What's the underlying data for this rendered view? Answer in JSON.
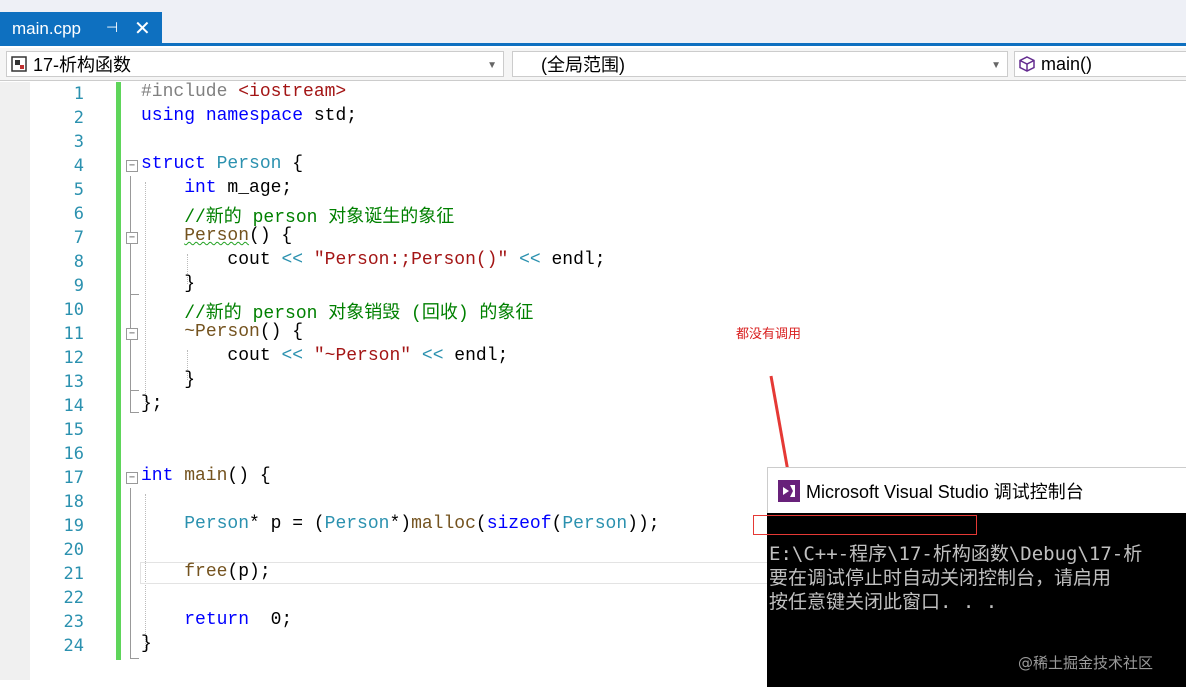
{
  "tab": {
    "title": "main.cpp",
    "pin": "⊣",
    "close": "✕"
  },
  "navbar": {
    "project": "17-析构函数",
    "scope": "(全局范围)",
    "member": "main()"
  },
  "editor": {
    "lines": [
      {
        "n": "1"
      },
      {
        "n": "2"
      },
      {
        "n": "3"
      },
      {
        "n": "4"
      },
      {
        "n": "5"
      },
      {
        "n": "6"
      },
      {
        "n": "7"
      },
      {
        "n": "8"
      },
      {
        "n": "9"
      },
      {
        "n": "10"
      },
      {
        "n": "11"
      },
      {
        "n": "12"
      },
      {
        "n": "13"
      },
      {
        "n": "14"
      },
      {
        "n": "15"
      },
      {
        "n": "16"
      },
      {
        "n": "17"
      },
      {
        "n": "18"
      },
      {
        "n": "19"
      },
      {
        "n": "20"
      },
      {
        "n": "21"
      },
      {
        "n": "22"
      },
      {
        "n": "23"
      },
      {
        "n": "24"
      }
    ],
    "code": {
      "l1a": "#include ",
      "l1b": "<iostream>",
      "l2a": "using",
      "l2b": " namespace",
      "l2c": " std;",
      "l4a": "struct",
      "l4b": " Person",
      "l4c": " {",
      "l5a": "    int",
      "l5b": " m_age;",
      "l6": "    //新的 person 对象诞生的象征",
      "l7a": "    ",
      "l7b": "Person",
      "l7c": "() {",
      "l8a": "        cout ",
      "l8b": "<<",
      "l8c": " \"Person:;Person()\"",
      "l8d": " ",
      "l8e": "<<",
      "l8f": " endl;",
      "l9": "    }",
      "l10": "    //新的 person 对象销毁 (回收) 的象征",
      "l11a": "    ",
      "l11b": "~Person",
      "l11c": "() {",
      "l12a": "        cout ",
      "l12b": "<<",
      "l12c": " \"~Person\"",
      "l12d": " ",
      "l12e": "<<",
      "l12f": " endl;",
      "l13": "    }",
      "l14": "};",
      "l17a": "int",
      "l17b": " main",
      "l17c": "() {",
      "l19a": "    ",
      "l19b": "Person",
      "l19c": "* p = (",
      "l19d": "Person",
      "l19e": "*)",
      "l19f": "malloc",
      "l19g": "(",
      "l19h": "sizeof",
      "l19i": "(",
      "l19j": "Person",
      "l19k": "));",
      "l21a": "    ",
      "l21b": "free",
      "l21c": "(p);",
      "l23a": "    ",
      "l23b": "return",
      "l23c": "  0;",
      "l24": "}"
    }
  },
  "annotation": "都没有调用",
  "console": {
    "title": "Microsoft Visual Studio 调试控制台",
    "lines": [
      "E:\\C++-程序\\17-析构函数\\Debug\\17-析",
      "要在调试停止时自动关闭控制台，请启用",
      "按任意键关闭此窗口. . ."
    ]
  },
  "watermark": "@稀土掘金技术社区",
  "colors": {
    "accent": "#0e70c0",
    "annotation": "#d92020",
    "change_bar": "#5ed55a"
  }
}
